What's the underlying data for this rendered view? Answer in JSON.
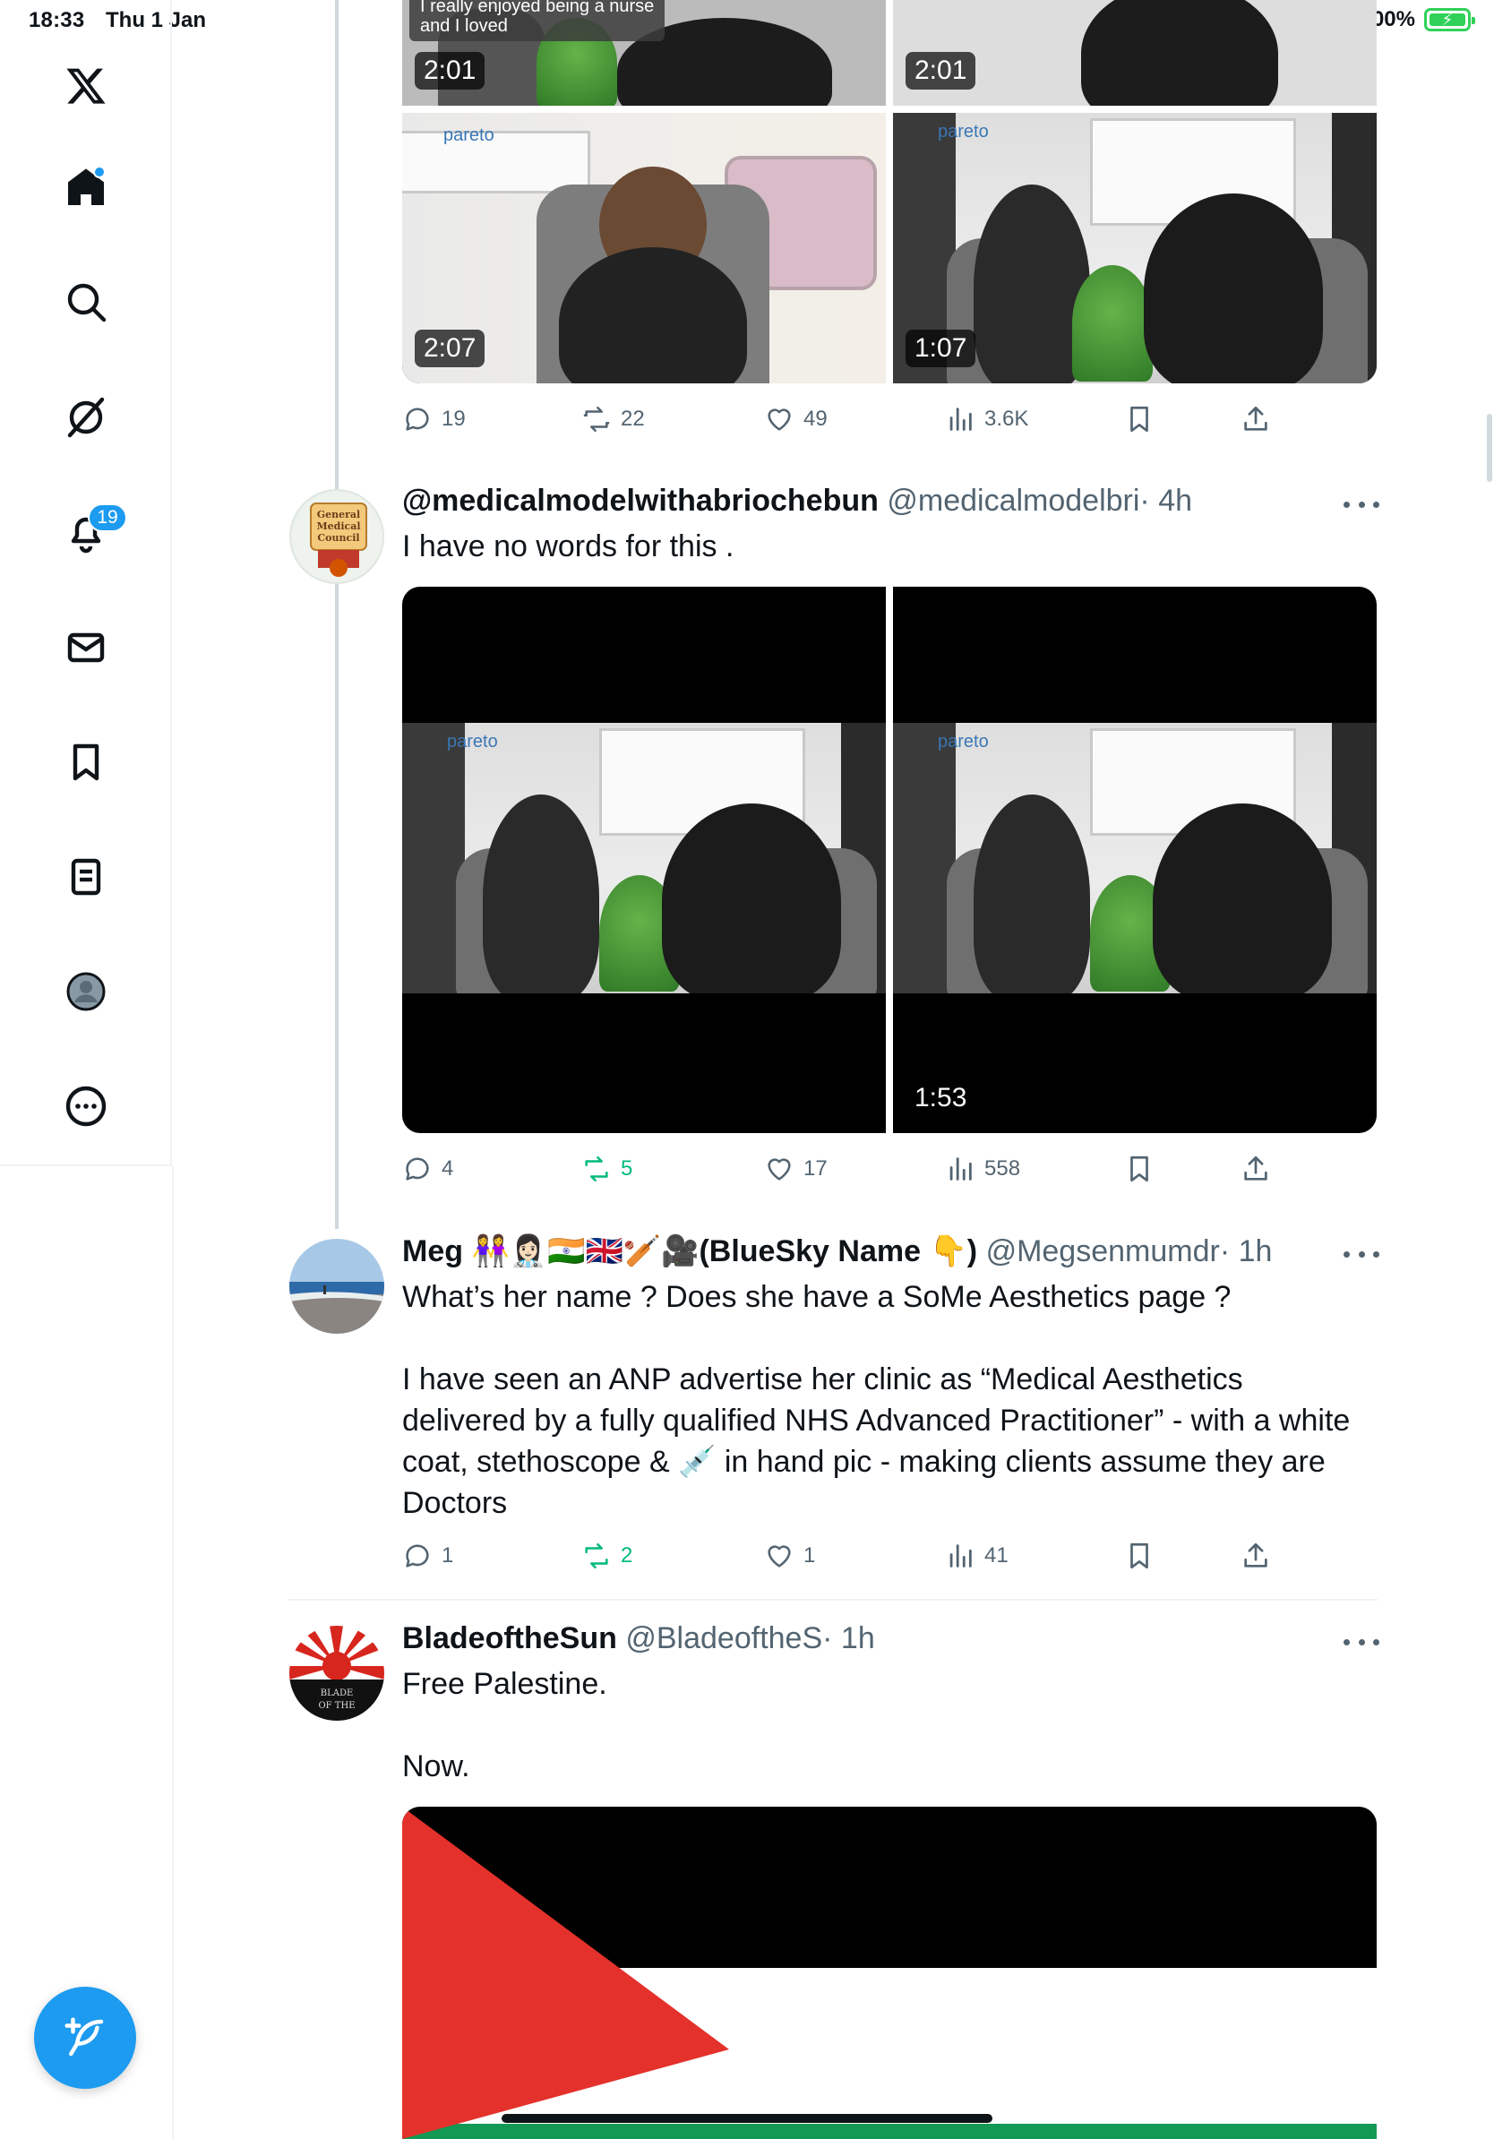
{
  "status_bar": {
    "time": "18:33",
    "date": "Thu 1 Jan",
    "battery": "100%"
  },
  "sidebar": {
    "notifications_count": "19",
    "items": [
      "home-icon",
      "search-icon",
      "grok-icon",
      "notifications-icon",
      "messages-icon",
      "bookmarks-icon",
      "lists-icon",
      "profile-icon",
      "more-icon"
    ]
  },
  "top_post": {
    "media": [
      {
        "duration": "2:01",
        "caption_line1": "I really enjoyed being a nurse",
        "caption_line2": "and I loved"
      },
      {
        "duration": "2:01"
      },
      {
        "duration": "2:07",
        "logo": "pareto"
      },
      {
        "duration": "1:07",
        "logo": "pareto"
      }
    ],
    "actions": {
      "replies": "19",
      "reposts": "22",
      "likes": "49",
      "views": "3.6K"
    }
  },
  "tweets": [
    {
      "name": "@medicalmodelwithabriochebun",
      "handle": "@medicalmodelbri",
      "time": "· 4h",
      "text": "I have no words for this .",
      "avatar_text": "General Medical Council",
      "media": [
        {
          "logo": "pareto"
        },
        {
          "logo": "pareto",
          "duration": "1:53"
        }
      ],
      "actions": {
        "replies": "4",
        "reposts": "5",
        "likes": "17",
        "views": "558"
      }
    },
    {
      "name": "Meg 👭👩🏻‍⚕️🇮🇳🇬🇧🏏🎥(BlueSky Name 👇)",
      "handle": "@Megsenmumdr",
      "time": "· 1h",
      "text": "What’s her name ? Does she have a SoMe Aesthetics page ?\n\nI have seen an ANP advertise her clinic as “Medical Aesthetics delivered by a fully qualified NHS Advanced Practitioner” - with a white coat, stethoscope & 💉 in hand pic - making clients assume they are Doctors",
      "actions": {
        "replies": "1",
        "reposts": "2",
        "likes": "1",
        "views": "41"
      }
    },
    {
      "name": "BladeoftheSun",
      "handle": "@BladeoftheS",
      "time": "· 1h",
      "text": "Free Palestine.\n\nNow.",
      "avatar_text": "BLADE OF THE",
      "actions": {}
    }
  ],
  "colors": {
    "accent": "#1d9bf0",
    "text": "#0f1419",
    "secondary": "#536471",
    "retweet": "#00ba7c",
    "flag_red": "#e4312b",
    "flag_green": "#149954"
  }
}
